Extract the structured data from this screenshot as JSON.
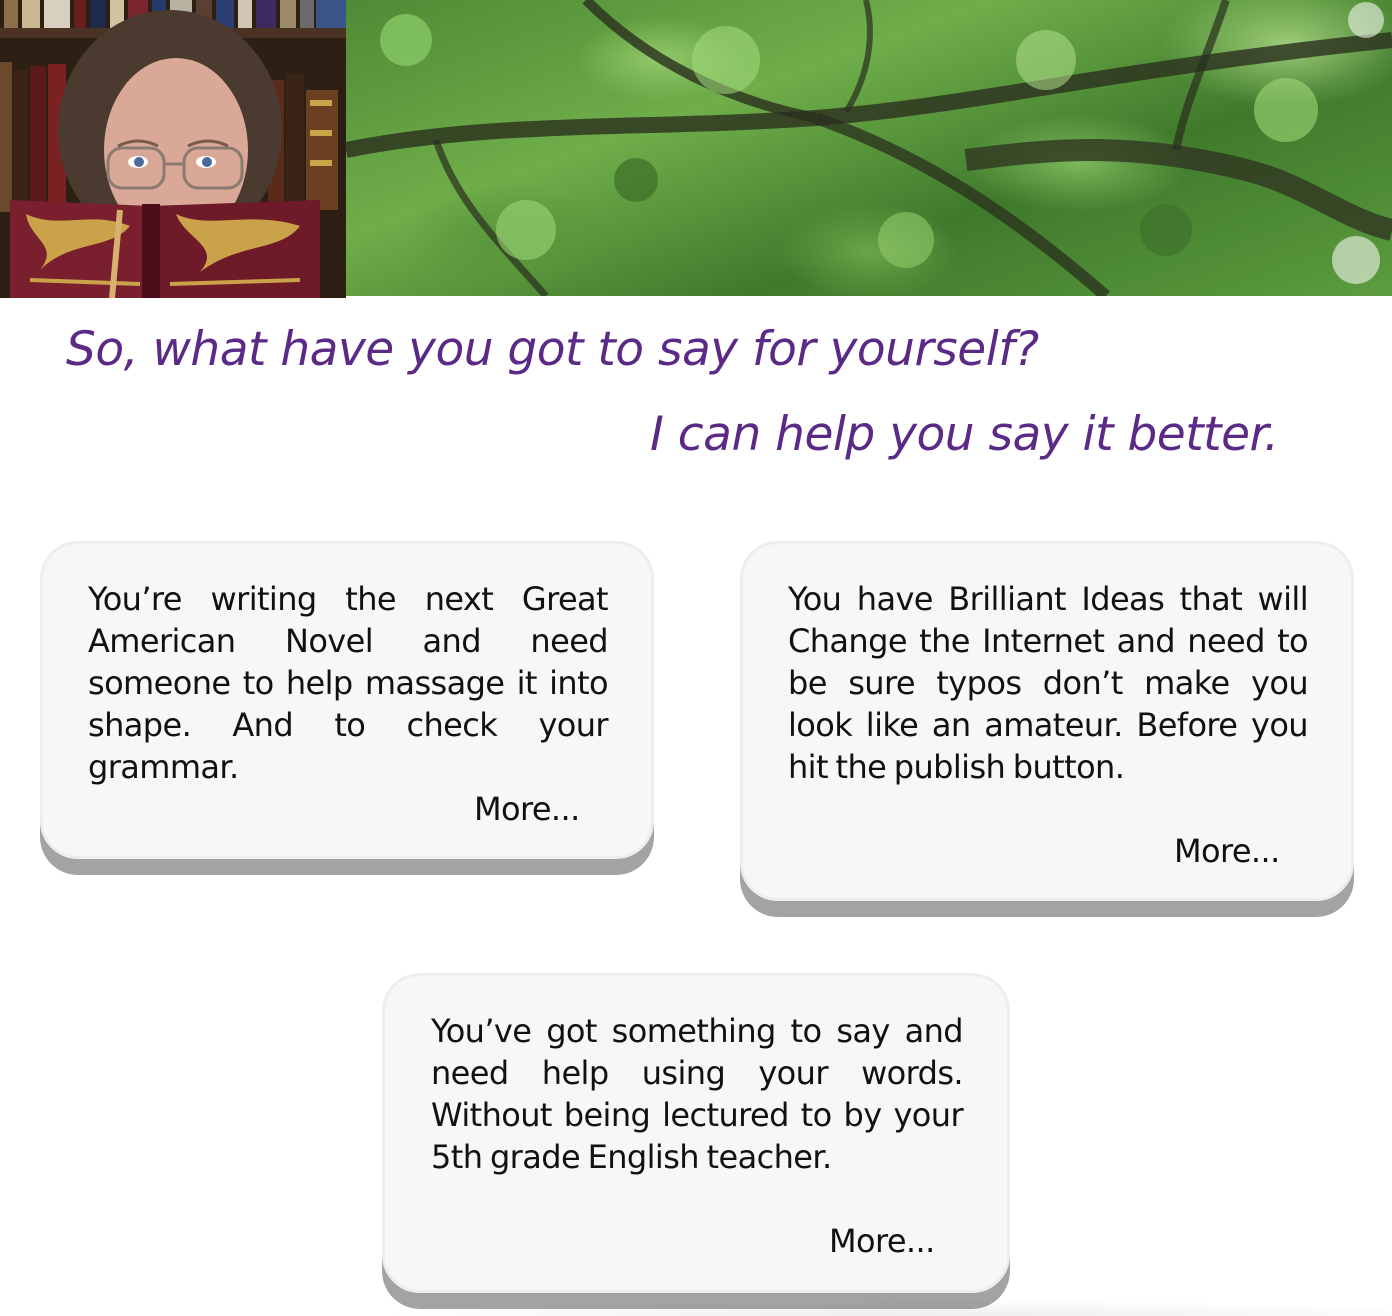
{
  "header": {
    "portrait_image": "woman-reading-book-photo",
    "canopy_image": "tree-canopy-photo",
    "colors": {
      "heading_purple": "#5b2a86",
      "card_background": "#f7f7f7",
      "card_shadow": "#a3a3a3",
      "card_text": "#111111"
    }
  },
  "main": {
    "headline": "So, what have you got to say for yourself?",
    "subheadline": "I can help you say it better."
  },
  "cards": [
    {
      "text": "You’re writing the next Great American Novel and need someone to help massage it into shape. And to check your grammar.",
      "more_label": "More..."
    },
    {
      "text": "You have Brilliant Ideas that will Change the Internet and need to be sure typos don’t make you look like an amateur. Before you hit the publish button.",
      "more_label": "More..."
    },
    {
      "text": "You’ve got something to say and need help using your words. Without being lectured to by your 5th grade English teacher.",
      "more_label": "More..."
    }
  ]
}
